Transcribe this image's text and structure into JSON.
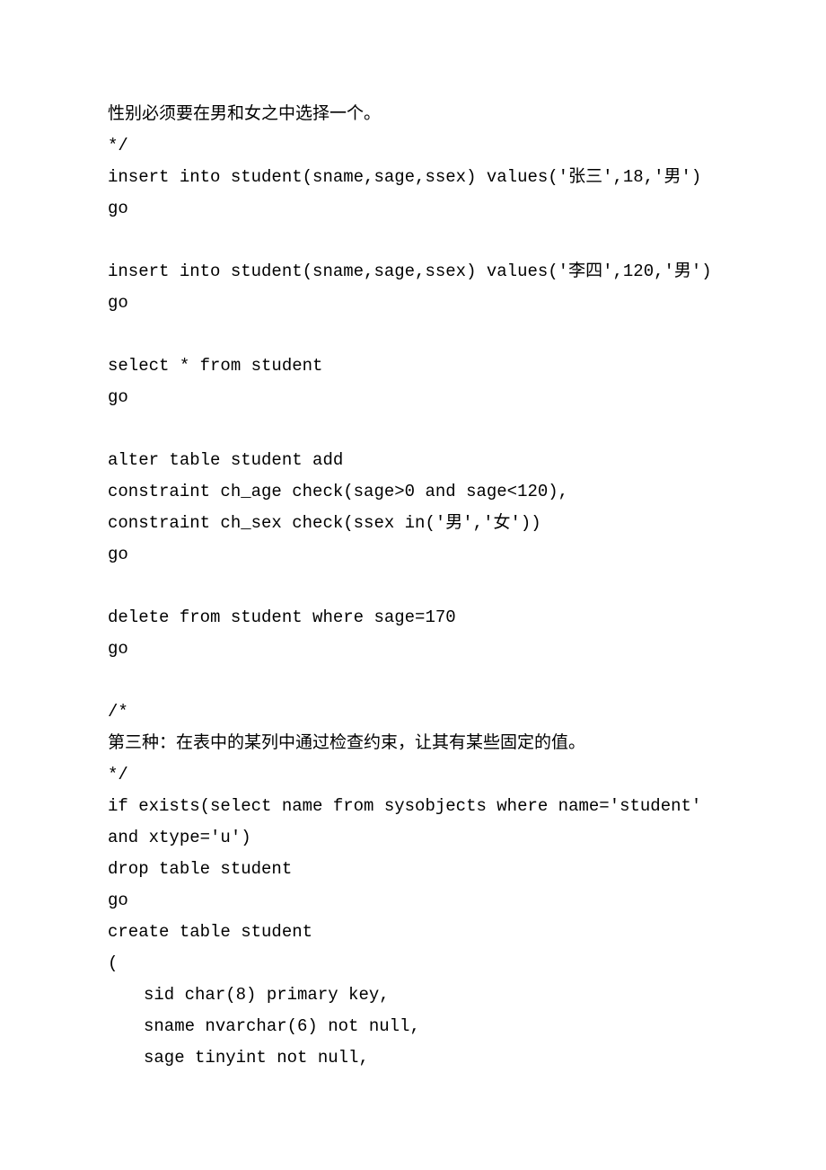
{
  "lines": [
    {
      "text": "性别必须要在男和女之中选择一个。",
      "indent": false
    },
    {
      "text": "*/",
      "indent": false
    },
    {
      "text": "insert into student(sname,sage,ssex) values('张三',18,'男')",
      "indent": false
    },
    {
      "text": "go",
      "indent": false
    },
    {
      "text": " ",
      "indent": false
    },
    {
      "text": "insert into student(sname,sage,ssex) values('李四',120,'男')",
      "indent": false
    },
    {
      "text": "go",
      "indent": false
    },
    {
      "text": " ",
      "indent": false
    },
    {
      "text": "select * from student",
      "indent": false
    },
    {
      "text": "go",
      "indent": false
    },
    {
      "text": " ",
      "indent": false
    },
    {
      "text": "alter table student add",
      "indent": false
    },
    {
      "text": "constraint ch_age check(sage>0 and sage<120),",
      "indent": false
    },
    {
      "text": "constraint ch_sex check(ssex in('男','女'))",
      "indent": false
    },
    {
      "text": "go",
      "indent": false
    },
    {
      "text": " ",
      "indent": false
    },
    {
      "text": "delete from student where sage=170",
      "indent": false
    },
    {
      "text": "go",
      "indent": false
    },
    {
      "text": " ",
      "indent": false
    },
    {
      "text": "/*",
      "indent": false
    },
    {
      "text": "第三种：在表中的某列中通过检查约束，让其有某些固定的值。",
      "indent": false
    },
    {
      "text": "*/",
      "indent": false
    },
    {
      "text": "if exists(select name from sysobjects where name='student' and xtype='u')",
      "indent": false
    },
    {
      "text": "drop table student",
      "indent": false
    },
    {
      "text": "go",
      "indent": false
    },
    {
      "text": "create table student",
      "indent": false
    },
    {
      "text": "(",
      "indent": false
    },
    {
      "text": "sid char(8) primary key,",
      "indent": true
    },
    {
      "text": "sname nvarchar(6) not null,",
      "indent": true
    },
    {
      "text": "sage tinyint not null,",
      "indent": true
    }
  ]
}
